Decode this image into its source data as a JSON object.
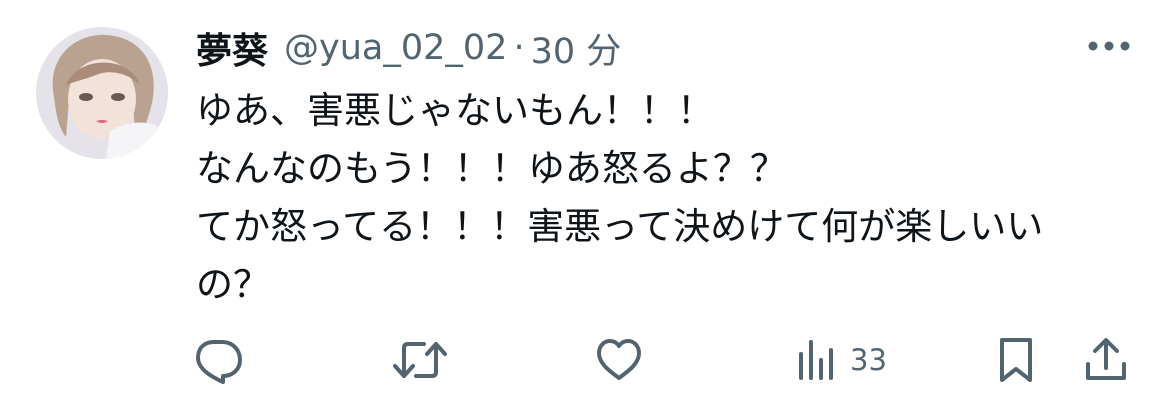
{
  "tweet": {
    "display_name": "夢葵",
    "handle": "@yua_02_02",
    "separator": "·",
    "time": "30 分",
    "lines": [
      "ゆあ、害悪じゃないもん！！！",
      "なんなのもう！！！ゆあ怒るよ？？",
      "てか怒ってる！！！害悪って決めけて何が楽しいい",
      "の？"
    ]
  },
  "actions": {
    "views_count": "33"
  },
  "icons": {
    "avatar": "avatar",
    "more": "more-icon",
    "reply": "reply-icon",
    "retweet": "retweet-icon",
    "like": "like-icon",
    "views": "views-icon",
    "bookmark": "bookmark-icon",
    "share": "share-icon"
  },
  "colors": {
    "text_primary": "#0f1419",
    "text_secondary": "#536471",
    "background": "#ffffff"
  }
}
